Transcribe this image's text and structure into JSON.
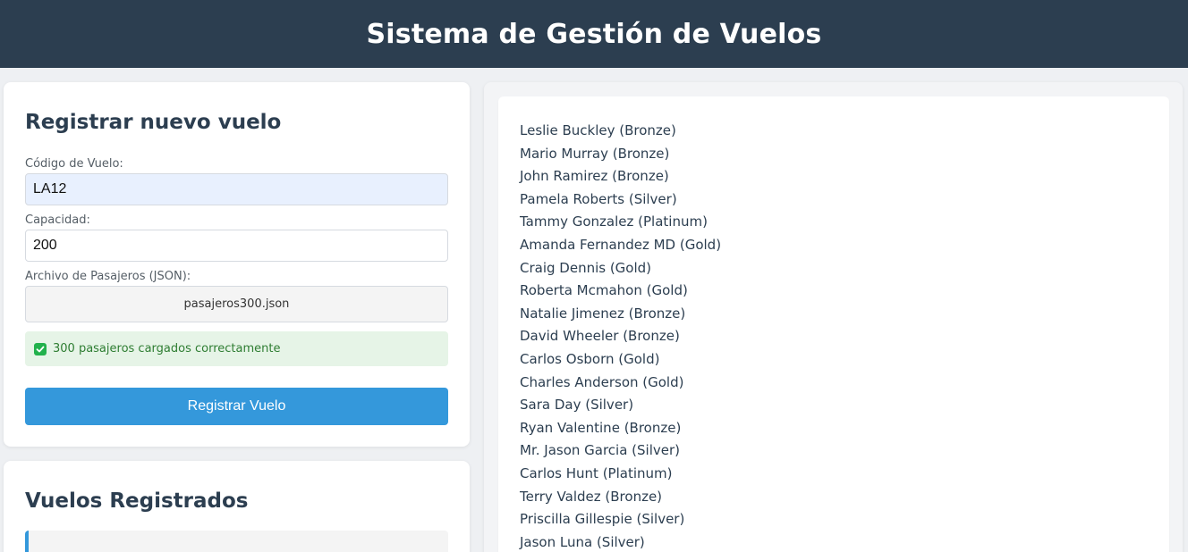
{
  "header": {
    "title": "Sistema de Gestión de Vuelos"
  },
  "form": {
    "title": "Registrar nuevo vuelo",
    "code_label": "Código de Vuelo:",
    "code_value": "LA12",
    "capacity_label": "Capacidad:",
    "capacity_value": "200",
    "file_label": "Archivo de Pasajeros (JSON):",
    "file_name": "pasajeros300.json",
    "success_message": "300 pasajeros cargados correctamente",
    "submit_label": "Registrar Vuelo"
  },
  "flights": {
    "title": "Vuelos Registrados"
  },
  "passengers": [
    "Leslie Buckley (Bronze)",
    "Mario Murray (Bronze)",
    "John Ramirez (Bronze)",
    "Pamela Roberts (Silver)",
    "Tammy Gonzalez (Platinum)",
    "Amanda Fernandez MD (Gold)",
    "Craig Dennis (Gold)",
    "Roberta Mcmahon (Gold)",
    "Natalie Jimenez (Bronze)",
    "David Wheeler (Bronze)",
    "Carlos Osborn (Gold)",
    "Charles Anderson (Gold)",
    "Sara Day (Silver)",
    "Ryan Valentine (Bronze)",
    "Mr. Jason Garcia (Silver)",
    "Carlos Hunt (Platinum)",
    "Terry Valdez (Bronze)",
    "Priscilla Gillespie (Silver)",
    "Jason Luna (Silver)"
  ],
  "colors": {
    "header_bg": "#2c3e50",
    "primary": "#3498db",
    "success_bg": "#e6f4e7",
    "success_text": "#2e7d32",
    "success_icon": "#22b14c"
  },
  "icons": {
    "success": "check-square-icon"
  }
}
